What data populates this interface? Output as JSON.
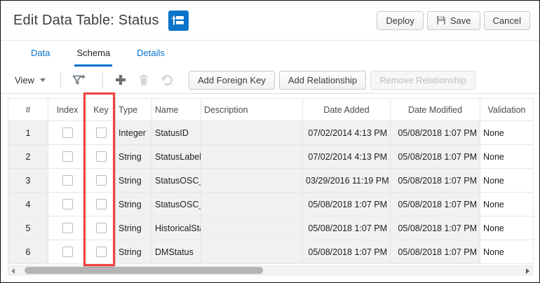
{
  "header": {
    "title": "Edit Data Table: Status",
    "buttons": {
      "deploy": "Deploy",
      "save": "Save",
      "cancel": "Cancel"
    }
  },
  "tabs": [
    {
      "label": "Data",
      "active": false
    },
    {
      "label": "Schema",
      "active": true
    },
    {
      "label": "Details",
      "active": false
    }
  ],
  "toolbar": {
    "view_label": "View",
    "add_foreign_key": "Add Foreign Key",
    "add_relationship": "Add Relationship",
    "remove_relationship": "Remove Relationship"
  },
  "table": {
    "columns": [
      "#",
      "Index",
      "Key",
      "Type",
      "Name",
      "Description",
      "Date Added",
      "Date Modified",
      "Validation"
    ],
    "rows": [
      {
        "num": "1",
        "index_checked": false,
        "key_checked": false,
        "type": "Integer",
        "name": "StatusID",
        "description": "",
        "date_added": "07/02/2014 4:13 PM",
        "date_modified": "05/08/2018 1:07 PM",
        "validation": "None"
      },
      {
        "num": "2",
        "index_checked": false,
        "key_checked": false,
        "type": "String",
        "name": "StatusLabel",
        "description": "",
        "date_added": "07/02/2014 4:13 PM",
        "date_modified": "05/08/2018 1:07 PM",
        "validation": "None"
      },
      {
        "num": "3",
        "index_checked": false,
        "key_checked": false,
        "type": "String",
        "name": "StatusOSC_t",
        "description": "",
        "date_added": "03/29/2016 11:19 PM",
        "date_modified": "05/08/2018 1:07 PM",
        "validation": "None"
      },
      {
        "num": "4",
        "index_checked": false,
        "key_checked": false,
        "type": "String",
        "name": "StatusOSC_l",
        "description": "",
        "date_added": "05/08/2018 1:07 PM",
        "date_modified": "05/08/2018 1:07 PM",
        "validation": "None"
      },
      {
        "num": "5",
        "index_checked": false,
        "key_checked": false,
        "type": "String",
        "name": "HistoricalStatus",
        "description": "",
        "date_added": "05/08/2018 1:07 PM",
        "date_modified": "05/08/2018 1:07 PM",
        "validation": "None"
      },
      {
        "num": "6",
        "index_checked": false,
        "key_checked": false,
        "type": "String",
        "name": "DMStatus",
        "description": "",
        "date_added": "05/08/2018 1:07 PM",
        "date_modified": "05/08/2018 1:07 PM",
        "validation": "None"
      }
    ]
  },
  "annotation": {
    "highlighted_column": "Key",
    "color": "#f4403d"
  },
  "colors": {
    "accent_blue": "#0572ce",
    "annotation_red": "#f4403d"
  }
}
